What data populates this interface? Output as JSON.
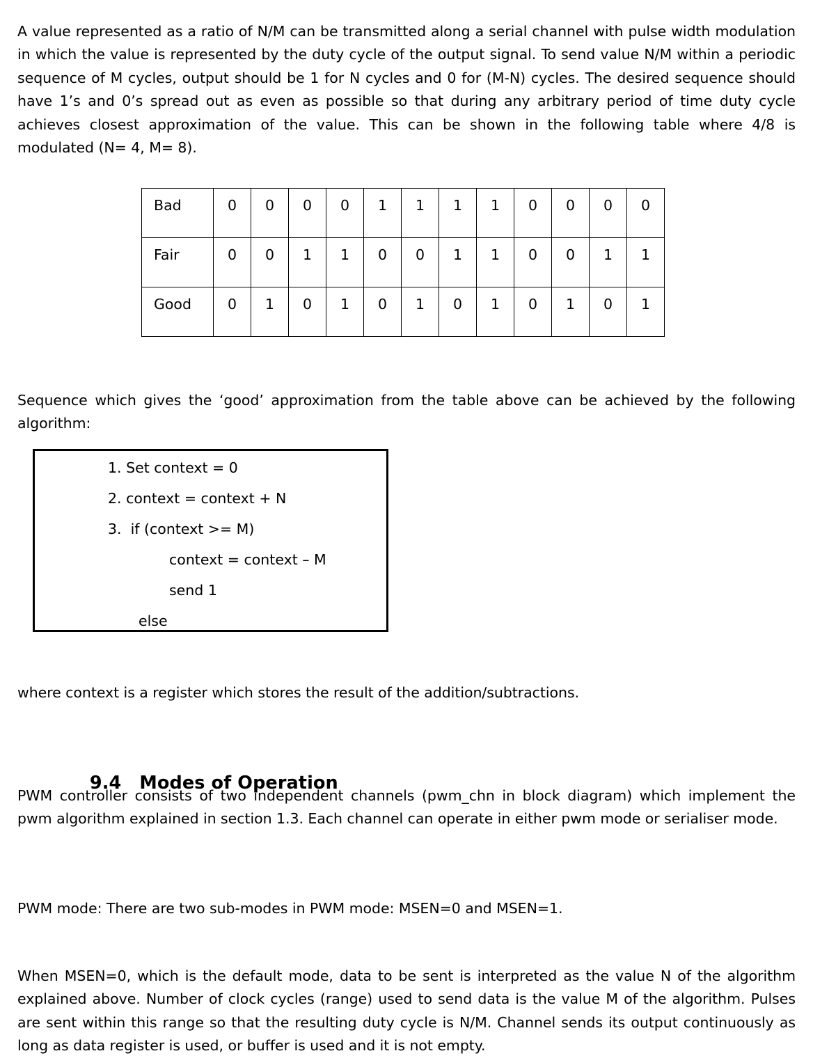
{
  "document": {
    "paragraphs": {
      "intro": "A value represented as a ratio of N/M can be transmitted along a serial channel with pulse width modulation in which the value is represented by the duty cycle of the output signal. To send value N/M within a periodic sequence of M cycles, output should be 1 for N cycles and 0 for (M-N) cycles. The desired sequence should have 1’s and 0’s spread out as even as possible so that during any arbitrary period of time duty cycle achieves closest approximation of the value. This can be shown in the following table where 4/8 is modulated (N= 4, M= 8).",
      "after_table": "Sequence which gives the ‘good’ approximation from the table above can be achieved by the following algorithm:",
      "after_algo": "where context is a register which stores the result of the addition/subtractions.",
      "modes_intro": "PWM controller consists of two independent channels (pwm_chn in block diagram) which implement the pwm algorithm explained in section 1.3. Each channel can operate in either pwm mode or serialiser mode.",
      "pwm_mode": "PWM mode: There are two sub-modes in PWM mode: MSEN=0 and MSEN=1.",
      "msen_zero": "When MSEN=0, which is the default mode, data to be sent is interpreted as the value N of the algorithm explained above. Number of clock cycles (range) used to send data is the value M of the algorithm. Pulses are sent within this range so that the resulting duty cycle is N/M. Channel sends its output continuously as long as data register is used, or buffer is used and it is not empty."
    },
    "sequence_table": {
      "rows": [
        {
          "label": "Bad",
          "bits": [
            "0",
            "0",
            "0",
            "0",
            "1",
            "1",
            "1",
            "1",
            "0",
            "0",
            "0",
            "0"
          ]
        },
        {
          "label": "Fair",
          "bits": [
            "0",
            "0",
            "1",
            "1",
            "0",
            "0",
            "1",
            "1",
            "0",
            "0",
            "1",
            "1"
          ]
        },
        {
          "label": "Good",
          "bits": [
            "0",
            "1",
            "0",
            "1",
            "0",
            "1",
            "0",
            "1",
            "0",
            "1",
            "0",
            "1"
          ]
        }
      ]
    },
    "algorithm_box": {
      "lines": [
        "1. Set context = 0",
        "2. context = context + N",
        "3.  if (context >= M)",
        "context = context – M",
        "send 1",
        "else"
      ]
    },
    "section": {
      "number": "9.4",
      "title": "Modes of Operation"
    }
  }
}
